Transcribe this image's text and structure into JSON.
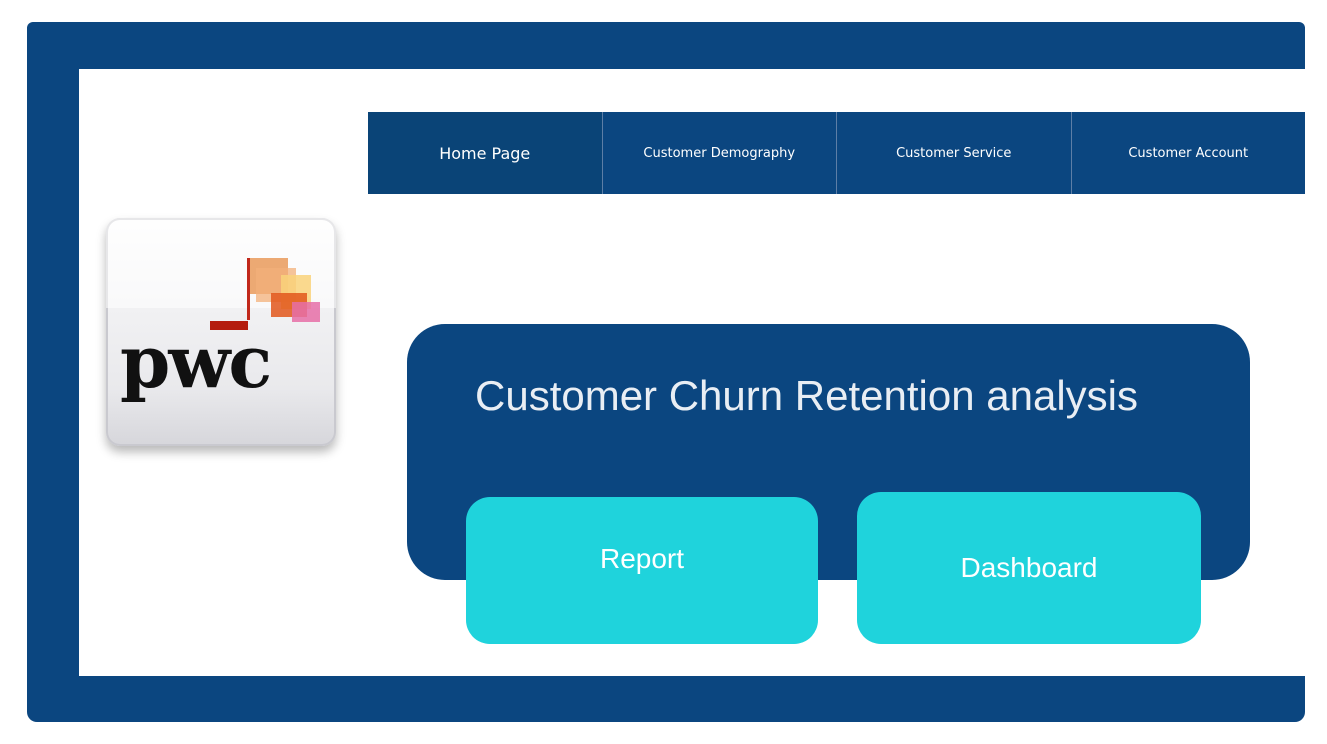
{
  "nav": {
    "items": [
      {
        "label": "Home Page",
        "active": true
      },
      {
        "label": "Customer Demography"
      },
      {
        "label": "Customer Service"
      },
      {
        "label": "Customer Account"
      }
    ]
  },
  "logo": {
    "text": "pwc"
  },
  "main": {
    "title": "Customer Churn Retention analysis",
    "report_label": "Report",
    "dashboard_label": "Dashboard"
  },
  "colors": {
    "primary": "#0b4680",
    "accent": "#1fd3dc",
    "background": "#ffffff"
  }
}
